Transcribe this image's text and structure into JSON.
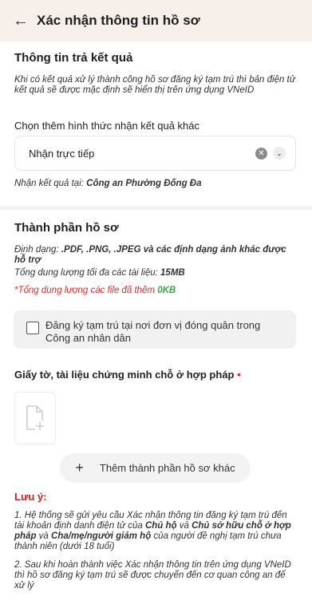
{
  "header": {
    "back_icon": "arrow-left-icon",
    "title": "Xác nhận thông tin hồ sơ"
  },
  "result_info": {
    "title": "Thông tin trả kết quả",
    "description": "Khi có kết quả xử lý thành công hồ sơ đăng ký tạm trú thì bản điện tử kết quả sẽ được mặc định sẽ hiển thị trên ứng dụng VNeID",
    "choose_label": "Chọn thêm hình thức nhận kết quả khác",
    "select_value": "Nhận trực tiếp",
    "receive_at_label": "Nhận kết quả tại: ",
    "receive_at_value": "Công an Phường Đống Đa"
  },
  "components": {
    "title": "Thành phần hồ sơ",
    "format_label": "Định dạng: ",
    "format_value": ".PDF, .PNG, .JPEG và các định dạng ảnh khác được hỗ trợ",
    "max_size_label": "Tổng dung lượng tối đa các tài liệu: ",
    "max_size_value": "15MB",
    "total_label": "*Tổng dung lượng các file đã thêm ",
    "total_value": "0KB",
    "checkbox_label": "Đăng ký tạm trú tại nơi đơn vị đóng quân trong Công an nhân dân",
    "doc_label": "Giấy tờ, tài liệu chứng minh chỗ ở hợp pháp",
    "required_mark": "•",
    "add_button": "Thêm thành phần hồ sơ khác"
  },
  "notes": {
    "title": "Lưu ý:",
    "n1_a": "1. Hệ thống sẽ gửi yêu cầu Xác nhận thông tin đăng ký tạm trú đến tài khoản định danh điện tử của ",
    "n1_b": "Chủ hộ",
    "n1_c": " và ",
    "n1_d": "Chủ sở hữu chỗ ở hợp pháp",
    "n1_e": " và ",
    "n1_f": "Cha/mẹ/người giám hộ",
    "n1_g": " của người đề nghị tạm trú chưa thành niên (dưới 18 tuổi)",
    "n2": "2. Sau khi hoàn thành việc Xác nhận thông tin trên ứng dụng VNeID thì hồ sơ đăng ký tạm trú sẽ được chuyển đến cơ quan công an để xử lý"
  },
  "colors": {
    "header_bg": "#f7efe9",
    "required": "#d82c2c",
    "accent_green": "#3aa64a"
  }
}
